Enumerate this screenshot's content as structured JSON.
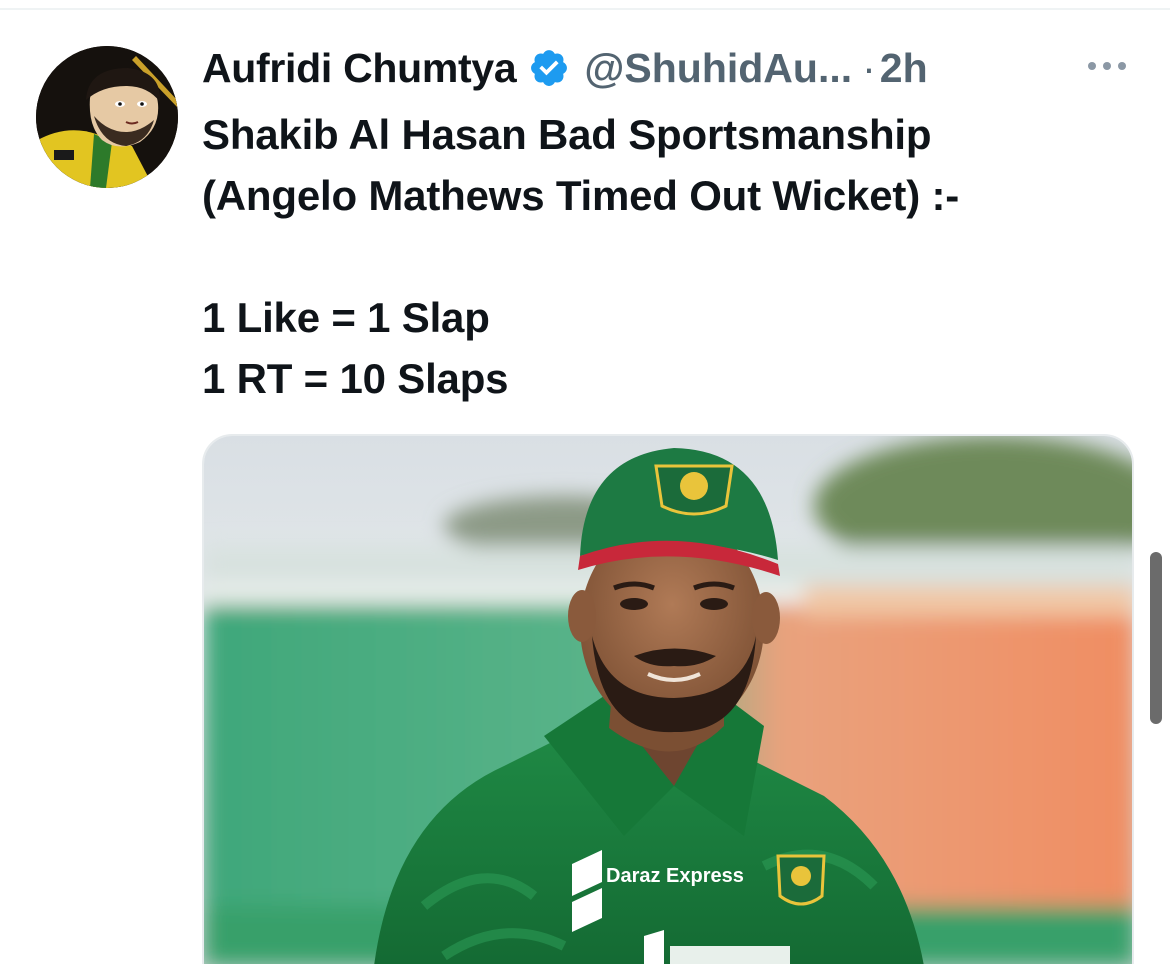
{
  "tweet": {
    "author": {
      "display_name": "Aufridi Chumtya",
      "verified": true,
      "handle": "@ShuhidAu...",
      "separator": "·",
      "time": "2h"
    },
    "text_lines": [
      "Shakib Al Hasan Bad Sportsmanship",
      "(Angelo Mathews Timed Out Wicket) :-",
      "",
      "1 Like = 1 Slap",
      "1 RT = 10 Slaps"
    ],
    "media": {
      "type": "photo",
      "jersey_text": "Daraz Express"
    }
  },
  "icons": {
    "verified": "verified-badge-icon",
    "more": "more-options-icon"
  },
  "colors": {
    "verified_blue": "#1d9bf0",
    "secondary_text": "#536471",
    "primary_text": "#0f1419",
    "jersey_green": "#1f7a3c"
  }
}
